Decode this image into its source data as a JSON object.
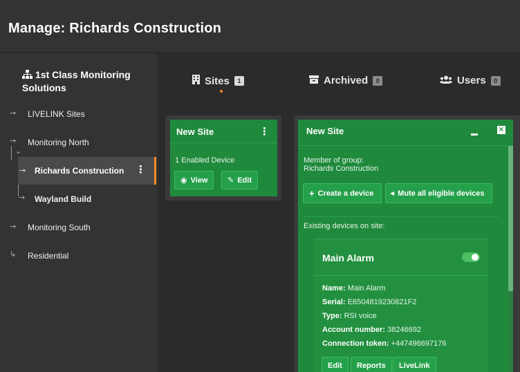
{
  "header": {
    "title": "Manage: Richards Construction"
  },
  "sidebar": {
    "org_name": "1st Class Monitoring Solutions",
    "items": [
      {
        "label": "LIVELINK Sites"
      },
      {
        "label": "Monitoring North"
      },
      {
        "label": "Richards Construction"
      },
      {
        "label": "Wayland Build"
      },
      {
        "label": "Monitoring South"
      },
      {
        "label": "Residential"
      }
    ]
  },
  "tabs": [
    {
      "label": "Sites",
      "count": "1",
      "icon": "building-icon",
      "active": true
    },
    {
      "label": "Archived",
      "count": "0",
      "icon": "archive-icon",
      "active": false
    },
    {
      "label": "Users",
      "count": "0",
      "icon": "users-icon",
      "active": false
    }
  ],
  "site_card": {
    "title": "New Site",
    "enabled_text": "1 Enabled Device",
    "view_label": "View",
    "edit_label": "Edit"
  },
  "detail_panel": {
    "title": "New Site",
    "member_label": "Member of group:",
    "group_name": "Richards Construction",
    "create_device_label": "Create a device",
    "mute_all_label": "Mute all eligible devices",
    "existing_devices_label": "Existing devices on site:",
    "device": {
      "title": "Main Alarm",
      "enabled": true,
      "name_label": "Name:",
      "name_value": "Main Alarm",
      "serial_label": "Serial:",
      "serial_value": "E6504819230821F2",
      "type_label": "Type:",
      "type_value": "RSI voice",
      "account_label": "Account number:",
      "account_value": "38246692",
      "token_label": "Connection token:",
      "token_value": "+447496697176",
      "edit_label": "Edit",
      "reports_label": "Reports",
      "livelink_label": "LiveLink"
    }
  },
  "colors": {
    "accent": "#f08a24",
    "card_green": "#1f8a3c",
    "background": "#2b2b2b"
  }
}
